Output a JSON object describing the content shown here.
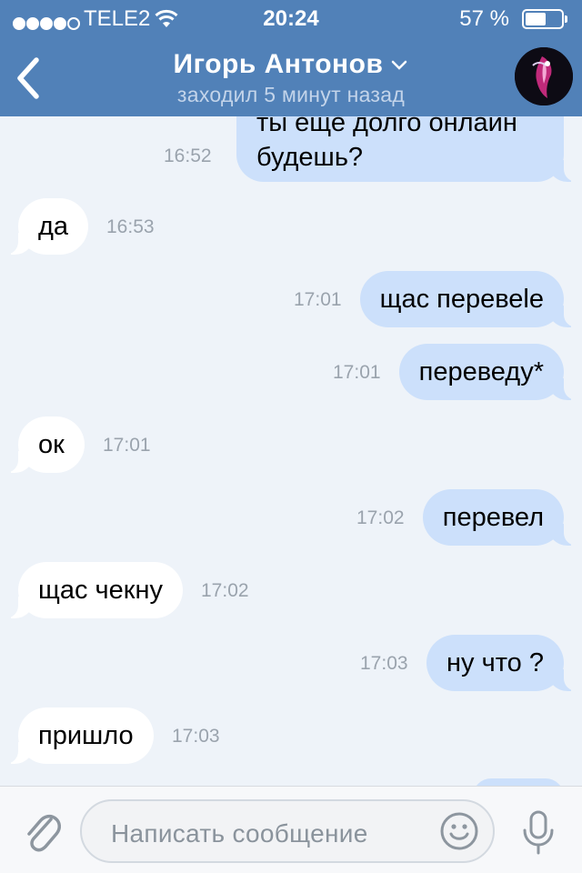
{
  "status_bar": {
    "carrier": "TELE2",
    "time": "20:24",
    "battery_percent": "57 %",
    "battery_level": 0.57,
    "signal_bars_filled": 4,
    "signal_bars_total": 5
  },
  "header": {
    "contact_name": "Игорь Антонов",
    "contact_status": "заходил 5 минут назад",
    "accent_color": "#5181b8"
  },
  "first_message": {
    "line1": "ты еще долго онлайн",
    "line2": "будешь?",
    "time": "16:52"
  },
  "messages": [
    {
      "direction": "in",
      "text": "да",
      "time": "16:53"
    },
    {
      "direction": "out",
      "text": "щас перевеle",
      "time": "17:01"
    },
    {
      "direction": "out",
      "text": "переведу*",
      "time": "17:01"
    },
    {
      "direction": "in",
      "text": "ок",
      "time": "17:01"
    },
    {
      "direction": "out",
      "text": "перевел",
      "time": "17:02"
    },
    {
      "direction": "in",
      "text": "щас чекну",
      "time": "17:02"
    },
    {
      "direction": "out",
      "text": "ну что ?",
      "time": "17:03"
    },
    {
      "direction": "in",
      "text": "пришло",
      "time": "17:03"
    }
  ],
  "input": {
    "placeholder": "Написать сообщение"
  },
  "colors": {
    "incoming_bubble": "#ffffff",
    "outgoing_bubble": "#cce0fb",
    "chat_background": "#eef3f9",
    "timestamp": "#9aa3ad"
  }
}
